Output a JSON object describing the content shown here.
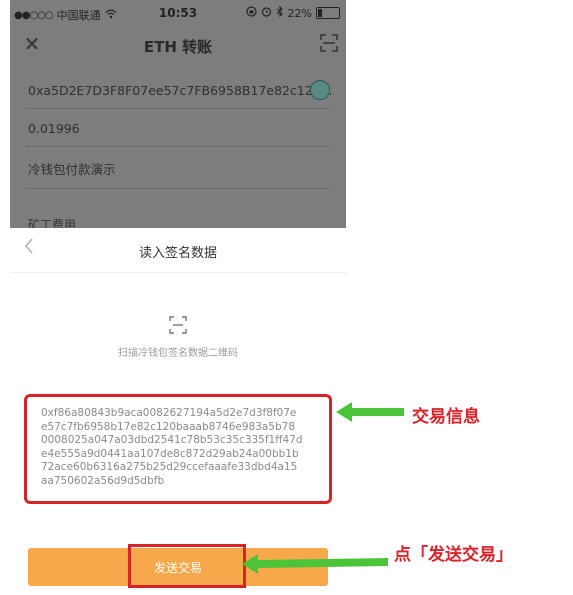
{
  "status_bar": {
    "signal": "●●○○○",
    "carrier": "中国联通",
    "time": "10:53",
    "battery": "22%",
    "battery_level": 0.22
  },
  "nav": {
    "title": "ETH 转账"
  },
  "form": {
    "address": "0xa5D2E7D3F8F07ee57c7FB6958B17e82c120...",
    "amount": "0.01996",
    "note": "冷钱包付款演示",
    "partial_field": "矿工费用"
  },
  "sheet": {
    "title": "读入签名数据",
    "scan_hint": "扫描冷钱包签名数据二维码",
    "tx_lines": [
      "0xf86a80843b9aca0082627194a5d2e7d3f8f07e",
      "e57c7fb6958b17e82c120baaab8746e983a5b78",
      "0008025a047a03dbd2541c78b53c35c335f1ff47d",
      "e4e555a9d0441aa107de8c872d29ab24a00bb1b",
      "72ace60b6316a275b25d29ccefaaafe33dbd4a15",
      "aa750602a56d9d5dbfb"
    ],
    "send_label": "发送交易"
  },
  "annotations": {
    "tx_info": "交易信息",
    "click_send": "点「发送交易」"
  },
  "colors": {
    "highlight": "#d8232a",
    "arrow": "#4cc43a",
    "button": "#f7a84a"
  }
}
